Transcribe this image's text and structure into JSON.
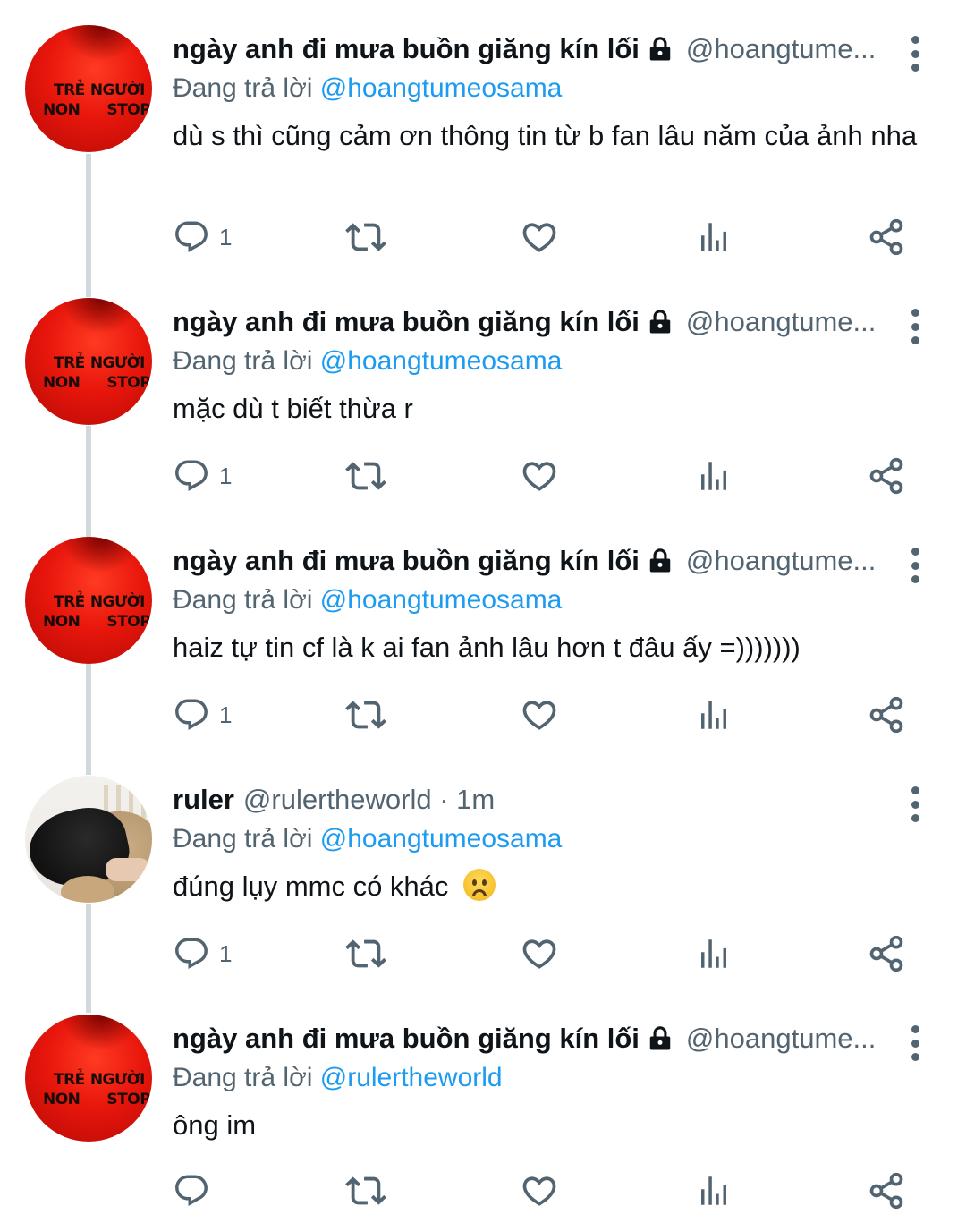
{
  "colors": {
    "accent": "#1d9bf0",
    "muted": "#536471",
    "text": "#0f1419",
    "thread": "#cfd9de"
  },
  "tweets": [
    {
      "name": "ngày anh đi mưa buồn giăng kín lối",
      "handle": "@hoangtume...",
      "replying_label": "Đang trả lời",
      "replying_to": "@hoangtumeosama",
      "text": "dù s thì cũng cảm ơn thông tin từ b fan lâu năm của ảnh nha",
      "reply_count": "1",
      "avatar_text_1": "TRẺ",
      "avatar_text_2": "NGƯỜI",
      "avatar_text_3": "NON",
      "avatar_text_4": "STOP"
    },
    {
      "name": "ngày anh đi mưa buồn giăng kín lối",
      "handle": "@hoangtume...",
      "replying_label": "Đang trả lời",
      "replying_to": "@hoangtumeosama",
      "text": "mặc dù t biết thừa r",
      "reply_count": "1",
      "avatar_text_1": "TRẺ",
      "avatar_text_2": "NGƯỜI",
      "avatar_text_3": "NON",
      "avatar_text_4": "STOP"
    },
    {
      "name": "ngày anh đi mưa buồn giăng kín lối",
      "handle": "@hoangtume...",
      "replying_label": "Đang trả lời",
      "replying_to": "@hoangtumeosama",
      "text": "haiz tự tin cf là k ai fan ảnh lâu hơn t đâu ấy =)))))))",
      "reply_count": "1",
      "avatar_text_1": "TRẺ",
      "avatar_text_2": "NGƯỜI",
      "avatar_text_3": "NON",
      "avatar_text_4": "STOP"
    },
    {
      "name": "ruler",
      "handle": "@rulertheworld · 1m",
      "replying_label": "Đang trả lời",
      "replying_to": "@hoangtumeosama",
      "text": "đúng lụy mmc có khác",
      "emoji": "worried-face-emoji",
      "reply_count": "1"
    },
    {
      "name": "ngày anh đi mưa buồn giăng kín lối",
      "handle": "@hoangtume...",
      "replying_label": "Đang trả lời",
      "replying_to": "@rulertheworld",
      "text": "ông im",
      "reply_count": "",
      "avatar_text_1": "TRẺ",
      "avatar_text_2": "NGƯỜI",
      "avatar_text_3": "NON",
      "avatar_text_4": "STOP"
    }
  ],
  "icons": {
    "reply": "reply-bubble-icon",
    "retweet": "retweet-icon",
    "like": "heart-icon",
    "views": "bar-chart-icon",
    "share": "share-icon",
    "more": "more-vertical-icon",
    "lock": "lock-icon"
  }
}
